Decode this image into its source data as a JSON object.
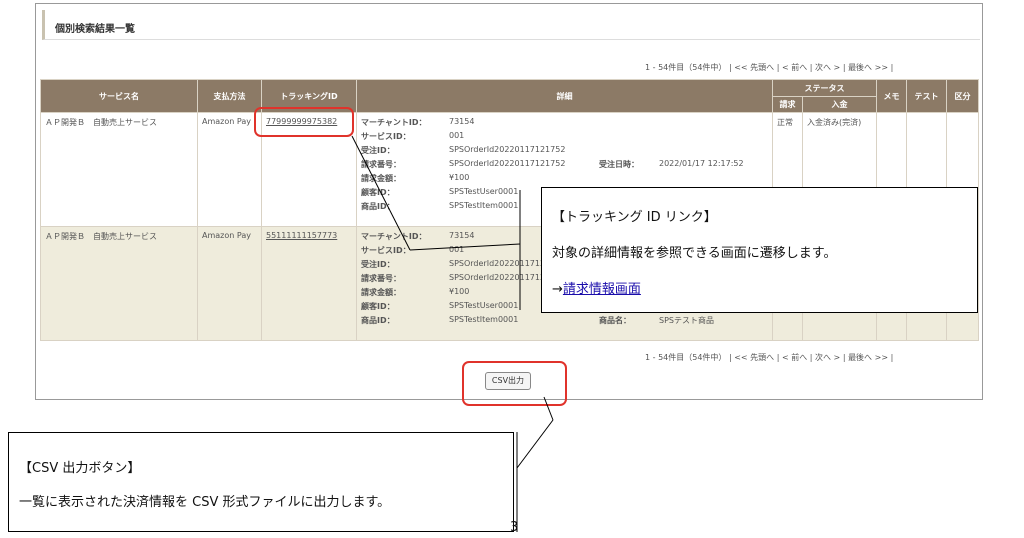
{
  "section_title": "個別検索結果一覧",
  "pager": {
    "range": "1 - 54件目（54件中）",
    "sep": "|",
    "first_sym": "<<",
    "first": "先頭へ",
    "prev": "< 前へ",
    "next": "次へ >",
    "last": "最後へ",
    "last_sym": ">>"
  },
  "table": {
    "headers": {
      "service": "サービス名",
      "payment": "支払方法",
      "tracking": "トラッキングID",
      "detail": "詳細",
      "status": "ステータス",
      "billing": "請求",
      "deposit": "入金",
      "memo": "メモ",
      "test": "テスト",
      "category": "区分"
    },
    "rows": [
      {
        "service": "ＡＰ開発Ｂ　自動売上サービス",
        "payment": "Amazon Pay",
        "tracking_id": "77999999975382",
        "details": {
          "merchant_label": "マーチャントID：",
          "merchant": "73154",
          "service_label": "サービスID：",
          "service": "001",
          "order_label": "受注ID：",
          "order": "SPSOrderId20220117121752",
          "bill_label": "請求番号：",
          "bill": "SPSOrderId20220117121752",
          "order_date_label": "受注日時：",
          "order_date": "2022/01/17 12:17:52",
          "amount_label": "請求金額：",
          "amount": "¥100",
          "customer_label": "顧客ID：",
          "customer": "SPSTestUser0001",
          "item_label": "商品ID：",
          "item": "SPSTestItem0001"
        },
        "billing_status": "正常",
        "deposit_status": "入金済み(完済)"
      },
      {
        "service": "ＡＰ開発Ｂ　自動売上サービス",
        "payment": "Amazon Pay",
        "tracking_id": "55111111157773",
        "details": {
          "merchant_label": "マーチャントID：",
          "merchant": "73154",
          "service_label": "サービスID：",
          "service": "001",
          "order_label": "受注ID：",
          "order": "SPSOrderId2022011712",
          "bill_label": "請求番号：",
          "bill": "SPSOrderId2022011712",
          "amount_label": "請求金額：",
          "amount": "¥100",
          "customer_label": "顧客ID：",
          "customer": "SPSTestUser0001",
          "item_label": "商品ID：",
          "item": "SPSTestItem0001",
          "item_name_label": "商品名：",
          "item_name": "SPSテスト商品"
        }
      }
    ]
  },
  "csv_button": "CSV出力",
  "callout_tracking": {
    "title": "【トラッキング ID リンク】",
    "text": "対象の詳細情報を参照できる画面に遷移します。",
    "arrow": "→",
    "link": "請求情報画面"
  },
  "callout_csv": {
    "title": "【CSV 出力ボタン】",
    "text": "一覧に表示された決済情報を CSV 形式ファイルに出力します。"
  },
  "page_number": "3",
  "colors": {
    "header_bg": "#8c7a66",
    "row_alt_bg": "#efecdc",
    "highlight": "#e0332b"
  }
}
